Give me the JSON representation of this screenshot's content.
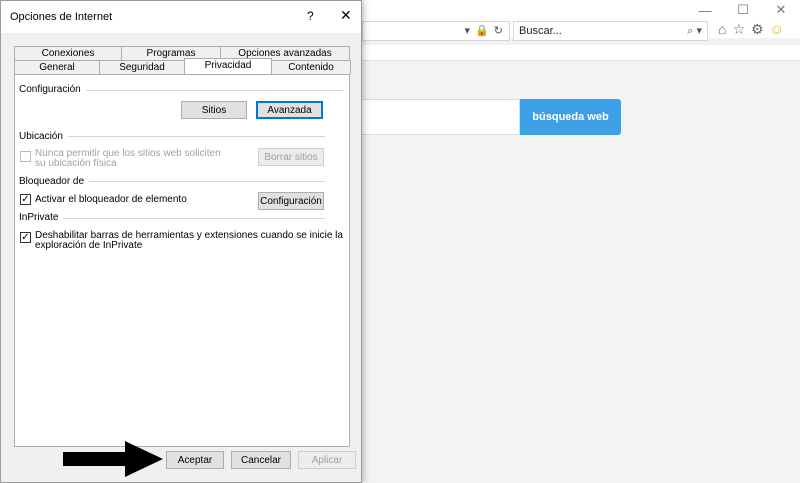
{
  "browser": {
    "search_placeholder": "Buscar...",
    "web_search_button": "búsqueda web",
    "accent_color": "#3d9fe6"
  },
  "dialog": {
    "title": "Opciones de Internet",
    "help": "?",
    "close": "✕",
    "tabs_top": [
      "Conexiones",
      "Programas",
      "Opciones avanzadas"
    ],
    "tabs_bottom": [
      "General",
      "Seguridad",
      "Privacidad",
      "Contenido"
    ],
    "active_tab": "Privacidad",
    "configuracion": {
      "label": "Configuración",
      "sites_button": "Sitios",
      "advanced_button": "Avanzada"
    },
    "ubicacion": {
      "label": "Ubicación",
      "checkbox_line1": "Nunca permitir que los sitios web soliciten",
      "checkbox_line2": "su ubicación física",
      "clear_sites_button": "Borrar sitios"
    },
    "bloqueador": {
      "label": "Bloqueador de",
      "checkbox": "Activar el bloqueador de elemento",
      "config_button": "Configuración"
    },
    "inprivate": {
      "label": "InPrivate",
      "checkbox_line1": "Deshabilitar barras de herramientas y extensiones cuando se inicie la",
      "checkbox_line2": "exploración de InPrivate"
    },
    "footer": {
      "ok": "Aceptar",
      "cancel": "Cancelar",
      "apply": "Aplicar"
    }
  }
}
